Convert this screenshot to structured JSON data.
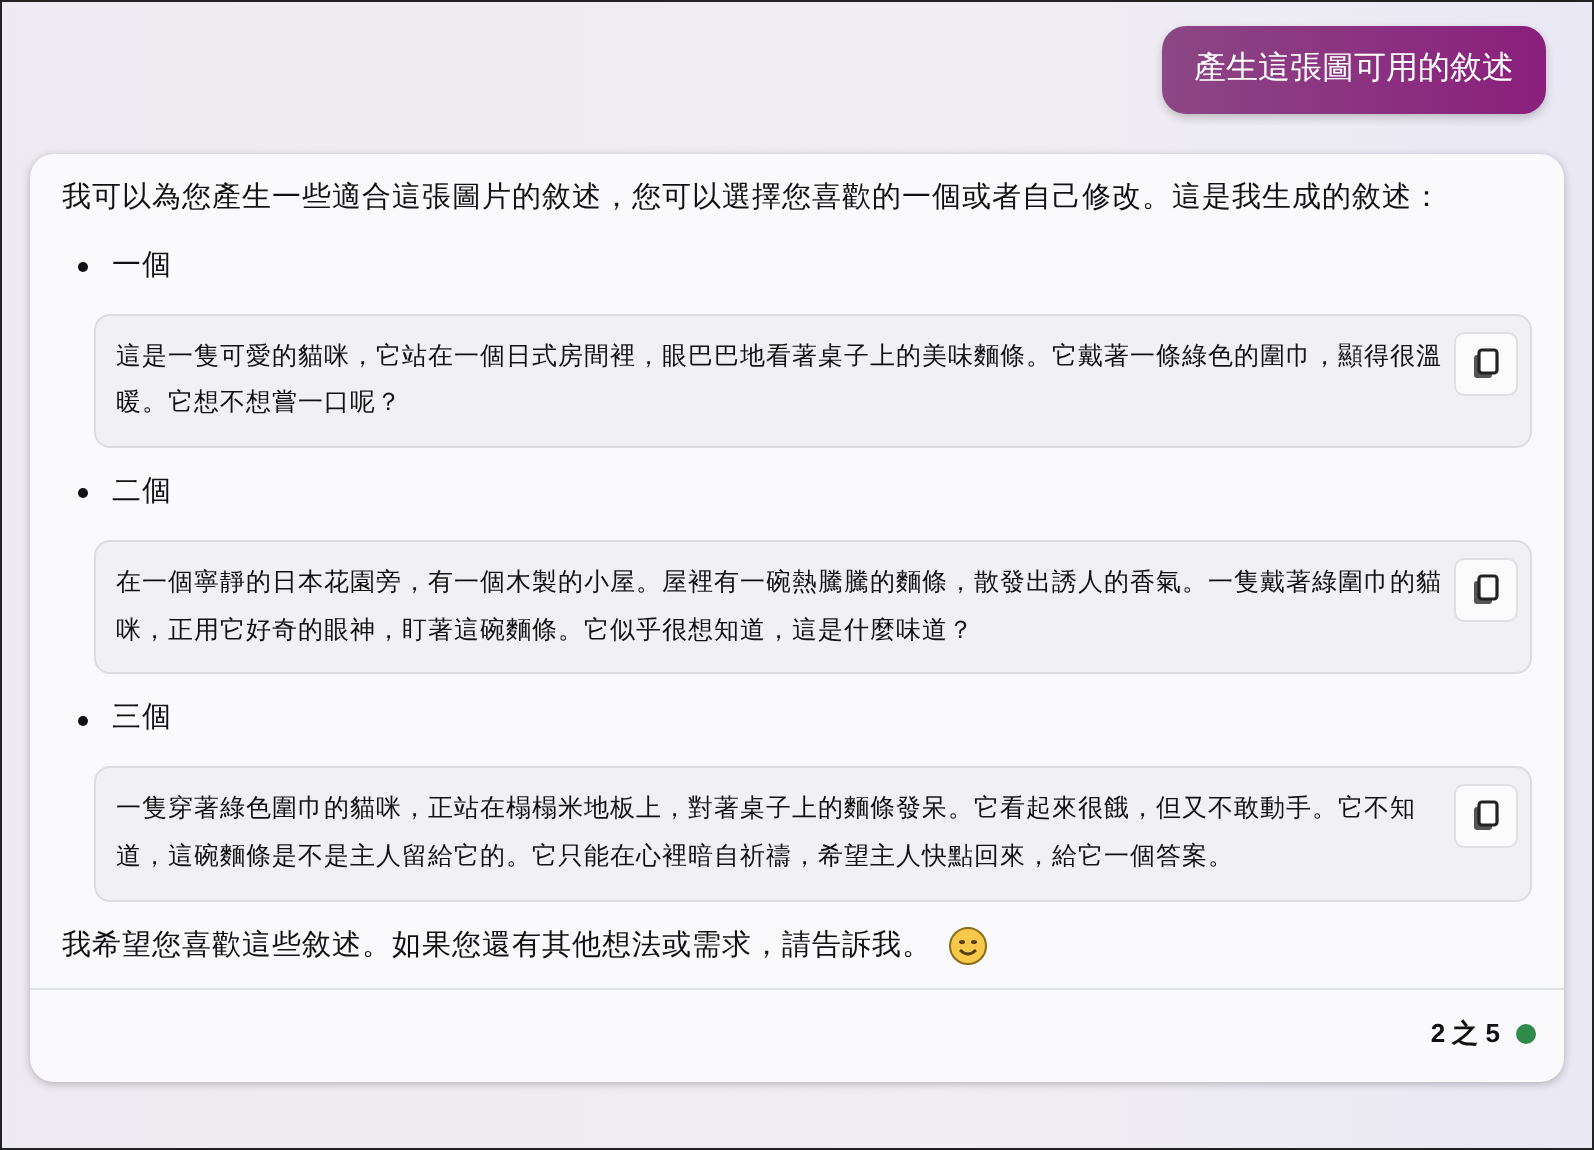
{
  "user_message": "產生這張圖可用的敘述",
  "reply": {
    "intro": "我可以為您產生一些適合這張圖片的敘述，您可以選擇您喜歡的一個或者自己修改。這是我生成的敘述：",
    "options": [
      {
        "label": "一個",
        "text": "這是一隻可愛的貓咪，它站在一個日式房間裡，眼巴巴地看著桌子上的美味麵條。它戴著一條綠色的圍巾，顯得很溫暖。它想不想嘗一口呢？"
      },
      {
        "label": "二個",
        "text": "在一個寧靜的日本花園旁，有一個木製的小屋。屋裡有一碗熱騰騰的麵條，散發出誘人的香氣。一隻戴著綠圍巾的貓咪，正用它好奇的眼神，盯著這碗麵條。它似乎很想知道，這是什麼味道？"
      },
      {
        "label": "三個",
        "text": "一隻穿著綠色圍巾的貓咪，正站在榻榻米地板上，對著桌子上的麵條發呆。它看起來很餓，但又不敢動手。它不知道，這碗麵條是不是主人留給它的。它只能在心裡暗自祈禱，希望主人快點回來，給它一個答案。"
      }
    ],
    "closing": "我希望您喜歡這些敘述。如果您還有其他想法或需求，請告訴我。",
    "page_counter": "2 之 5"
  }
}
